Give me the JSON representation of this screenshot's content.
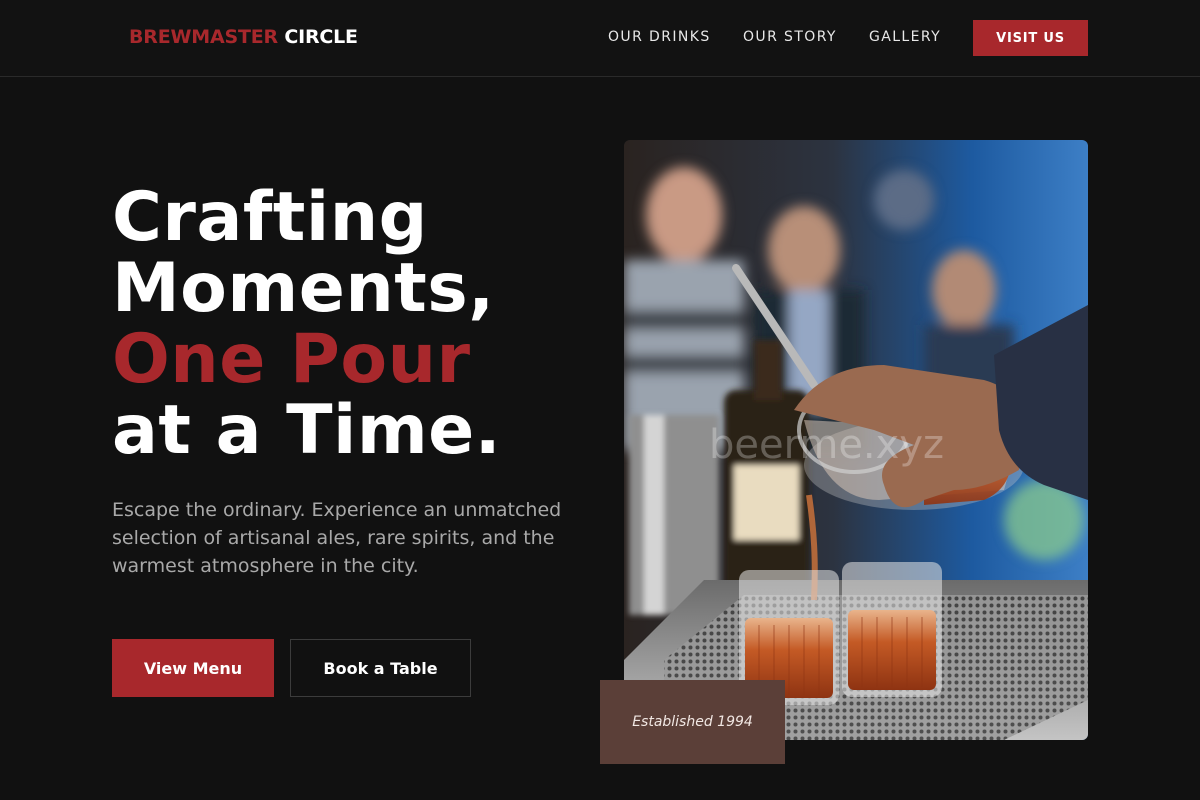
{
  "header": {
    "logo_part1": "BREWMASTER",
    "logo_part2": "CIRCLE",
    "nav": [
      "OUR DRINKS",
      "OUR STORY",
      "GALLERY"
    ],
    "cta": "VISIT US"
  },
  "hero": {
    "line1": "Crafting",
    "line2": "Moments,",
    "line3": "One Pour",
    "line4": "at a Time.",
    "description": "Escape the ordinary. Experience an unmatched selection of artisanal ales, rare spirits, and the warmest atmosphere in the city.",
    "primary_button": "View Menu",
    "secondary_button": "Book a Table",
    "badge": "Established 1994",
    "photo_watermark": "beerme.xyz"
  },
  "colors": {
    "background": "#111111",
    "accent": "#a8282c",
    "badge": "#5b3f38",
    "muted_text": "#a9a9a9"
  }
}
